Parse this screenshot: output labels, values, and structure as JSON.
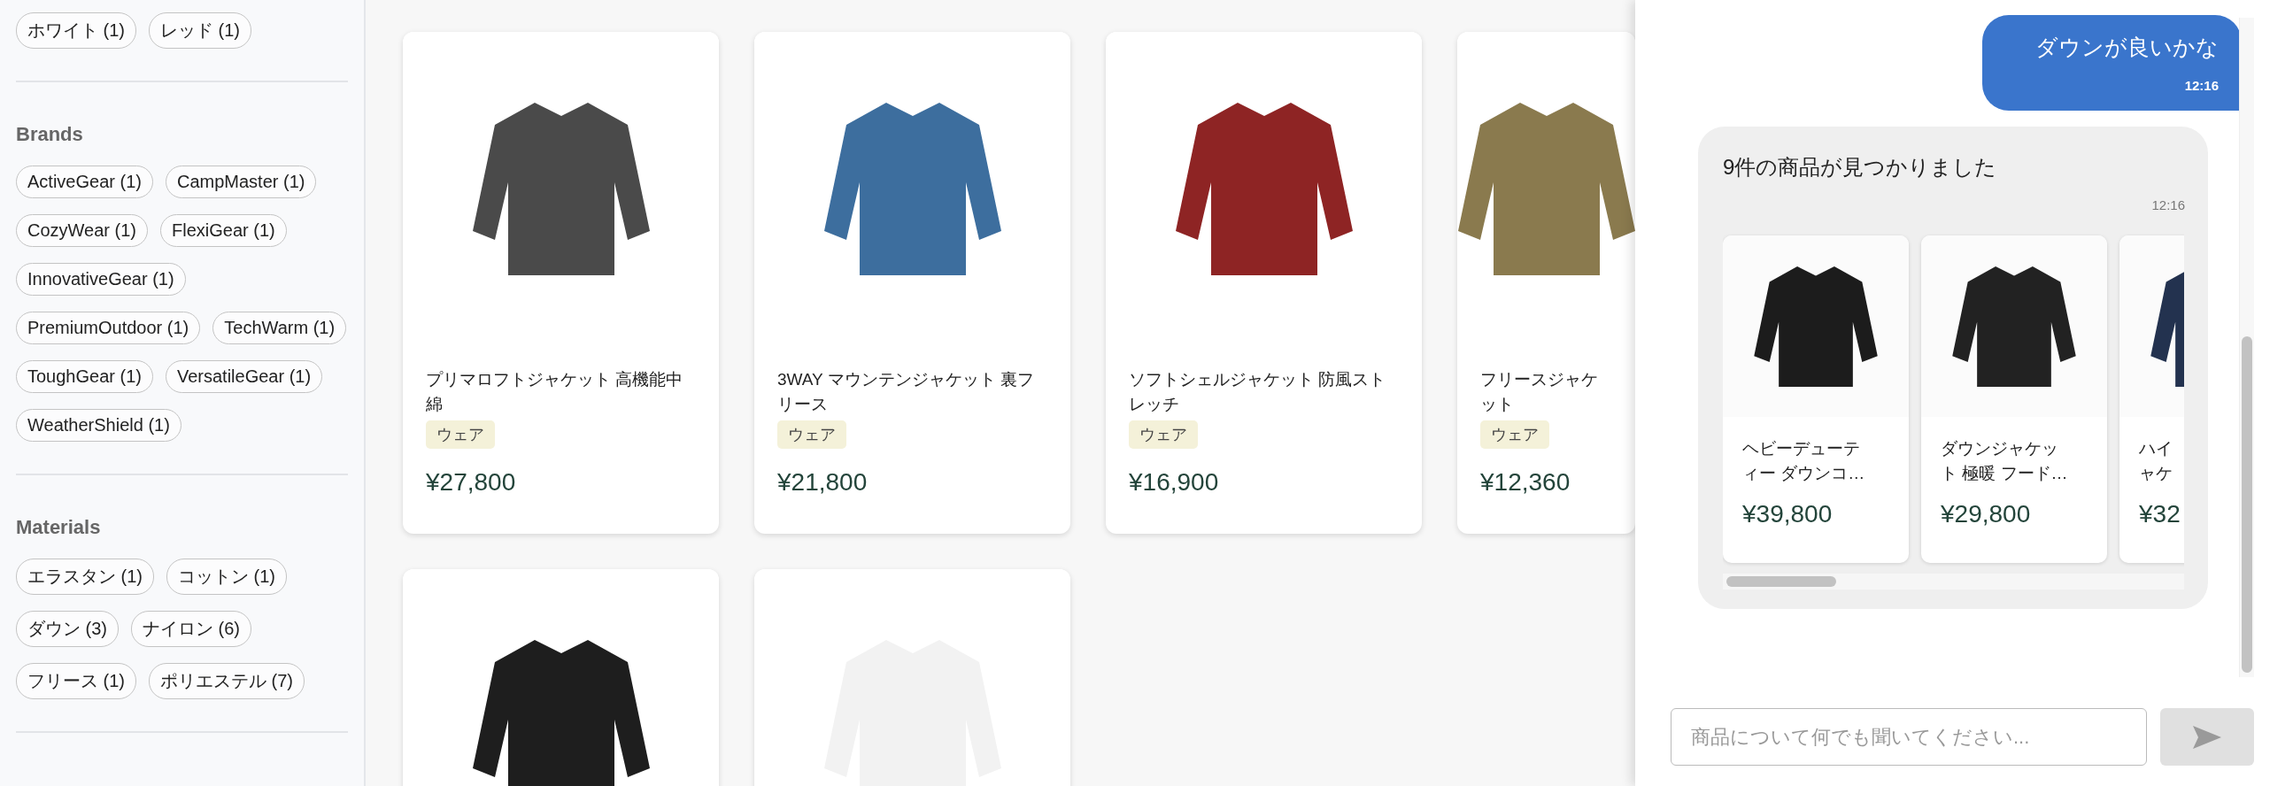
{
  "sidebar": {
    "color_chips": [
      {
        "label": "ホワイト (1)"
      },
      {
        "label": "レッド (1)"
      }
    ],
    "sections": [
      {
        "title": "Brands",
        "chips": [
          {
            "label": "ActiveGear (1)"
          },
          {
            "label": "CampMaster (1)"
          },
          {
            "label": "CozyWear (1)"
          },
          {
            "label": "FlexiGear (1)"
          },
          {
            "label": "InnovativeGear (1)"
          },
          {
            "label": "PremiumOutdoor (1)"
          },
          {
            "label": "TechWarm (1)"
          },
          {
            "label": "ToughGear (1)"
          },
          {
            "label": "VersatileGear (1)"
          },
          {
            "label": "WeatherShield (1)"
          }
        ]
      },
      {
        "title": "Materials",
        "chips": [
          {
            "label": "エラスタン (1)"
          },
          {
            "label": "コットン (1)"
          },
          {
            "label": "ダウン (3)"
          },
          {
            "label": "ナイロン (6)"
          },
          {
            "label": "フリース (1)"
          },
          {
            "label": "ポリエステル (7)"
          }
        ]
      }
    ]
  },
  "products": [
    {
      "title": "プリマロフトジャケット 高機能中綿",
      "tag": "ウェア",
      "price": "¥27,800",
      "color": "#4a4a4a"
    },
    {
      "title": "3WAY マウンテンジャケット 裏フリース",
      "tag": "ウェア",
      "price": "¥21,800",
      "color": "#3d6e9e"
    },
    {
      "title": "ソフトシェルジャケット 防風ストレッチ",
      "tag": "ウェア",
      "price": "¥16,900",
      "color": "#8e2424"
    },
    {
      "title": "フリースジャケット",
      "tag": "ウェア",
      "price": "¥12,360",
      "color": "#8a7a4e"
    },
    {
      "color": "#1e1e1e"
    },
    {
      "color": "#f2f2f2"
    }
  ],
  "chat": {
    "messages": [
      {
        "kind": "user",
        "text": "ダウンが良いかな",
        "time": "12:16"
      },
      {
        "kind": "bot",
        "text": "9件の商品が見つかりました",
        "time": "12:16",
        "results": [
          {
            "title_lines": [
              "ヘビーデューテ",
              "ィー ダウンコ…"
            ],
            "price": "¥39,800",
            "color": "#1c1c1c"
          },
          {
            "title_lines": [
              "ダウンジャケッ",
              "ト 極暖 フード…"
            ],
            "price": "¥29,800",
            "color": "#222222"
          },
          {
            "title_lines": [
              "ハイ",
              "ャケ"
            ],
            "price": "¥32",
            "color": "#23324f"
          }
        ]
      }
    ],
    "input": {
      "placeholder": "商品について何でも聞いてください..."
    }
  }
}
